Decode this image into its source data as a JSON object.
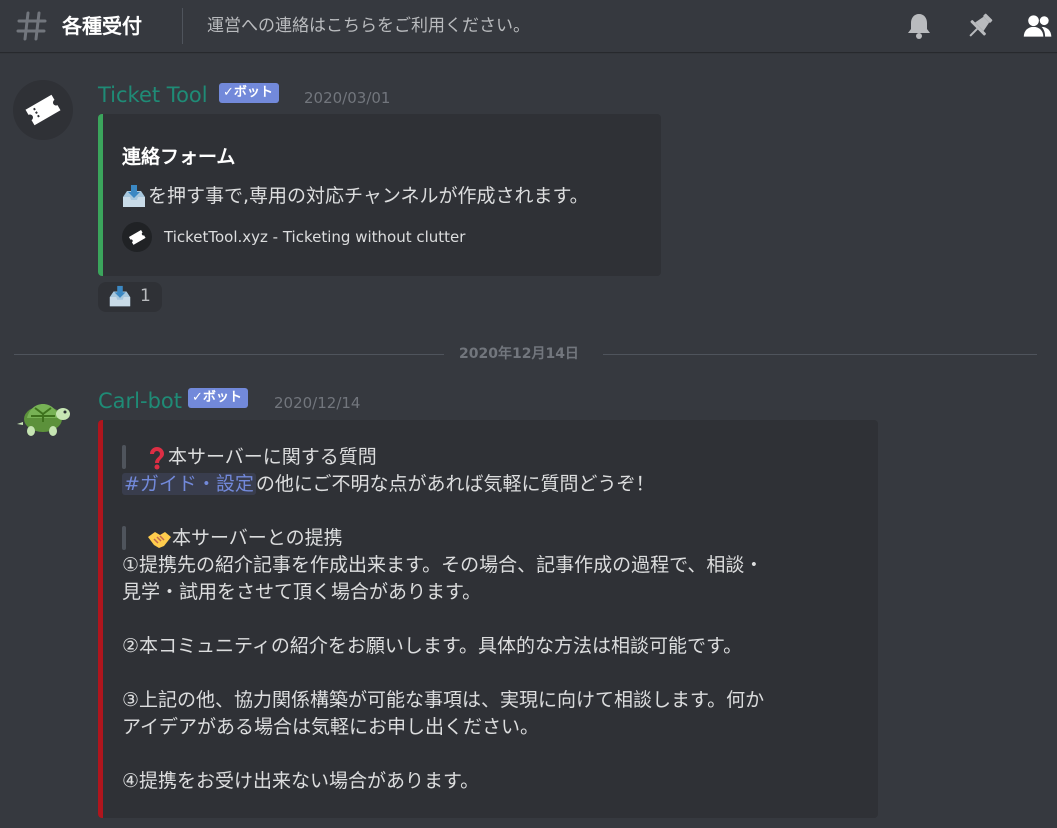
{
  "header": {
    "channel_name": "各種受付",
    "topic": "運営への連絡はこちらをご利用ください。"
  },
  "messages": [
    {
      "username": "Ticket Tool",
      "bot_tag": "✓ボット",
      "timestamp": "2020/03/01",
      "embed": {
        "bar_color": "#43b581",
        "title": "連絡フォーム",
        "description": "を押す事で,専用の対応チャンネルが作成されます。",
        "footer": "TicketTool.xyz - Ticketing without clutter"
      },
      "reaction": {
        "emoji": "inbox-tray",
        "count": "1"
      }
    },
    {
      "username": "Carl-bot",
      "bot_tag": "✓ボット",
      "timestamp": "2020/12/14",
      "embed": {
        "bar_color": "#b0151d",
        "quote1": "本サーバーに関する質問",
        "mention": "#ガイド・設定",
        "line2": "の他にご不明な点があれば気軽に質問どうぞ！",
        "quote2": "本サーバーとの提携",
        "p1a": "①提携先の紹介記事を作成出来ます。その場合、記事作成の過程で、相談・",
        "p1b": "見学・試用をさせて頂く場合があります。",
        "p2": "②本コミュニティの紹介をお願いします。具体的な方法は相談可能です。",
        "p3a": "③上記の他、協力関係構築が可能な事項は、実現に向けて相談します。何か",
        "p3b": "アイデアがある場合は気軽にお申し出ください。",
        "p4": "④提携をお受け出来ない場合があります。"
      }
    }
  ],
  "date_divider": "2020年12月14日",
  "icons": [
    "hash-icon",
    "bell-icon",
    "pin-icon",
    "members-icon",
    "ticket-icon",
    "turtle-icon",
    "inbox-tray-icon",
    "question-icon",
    "handshake-icon"
  ],
  "colors": {
    "background": "#36393f",
    "embed_bg": "#2f3136",
    "username": "#1f8b76",
    "bot_tag": "#7289da"
  }
}
